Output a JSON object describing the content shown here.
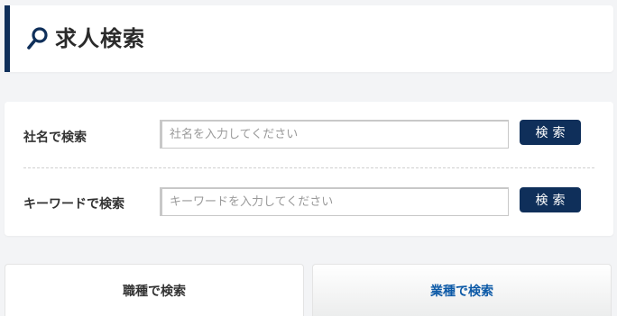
{
  "header": {
    "title": "求人検索",
    "icon": "search-icon"
  },
  "colors": {
    "accent": "#0f2f5a",
    "link": "#0d5aa7"
  },
  "search": {
    "company": {
      "label": "社名で検索",
      "placeholder": "社名を入力してください",
      "value": "",
      "button": "検索"
    },
    "keyword": {
      "label": "キーワードで検索",
      "placeholder": "キーワードを入力してください",
      "value": "",
      "button": "検索"
    }
  },
  "tabs": [
    {
      "label": "職種で検索",
      "active": true
    },
    {
      "label": "業種で検索",
      "active": false
    }
  ]
}
